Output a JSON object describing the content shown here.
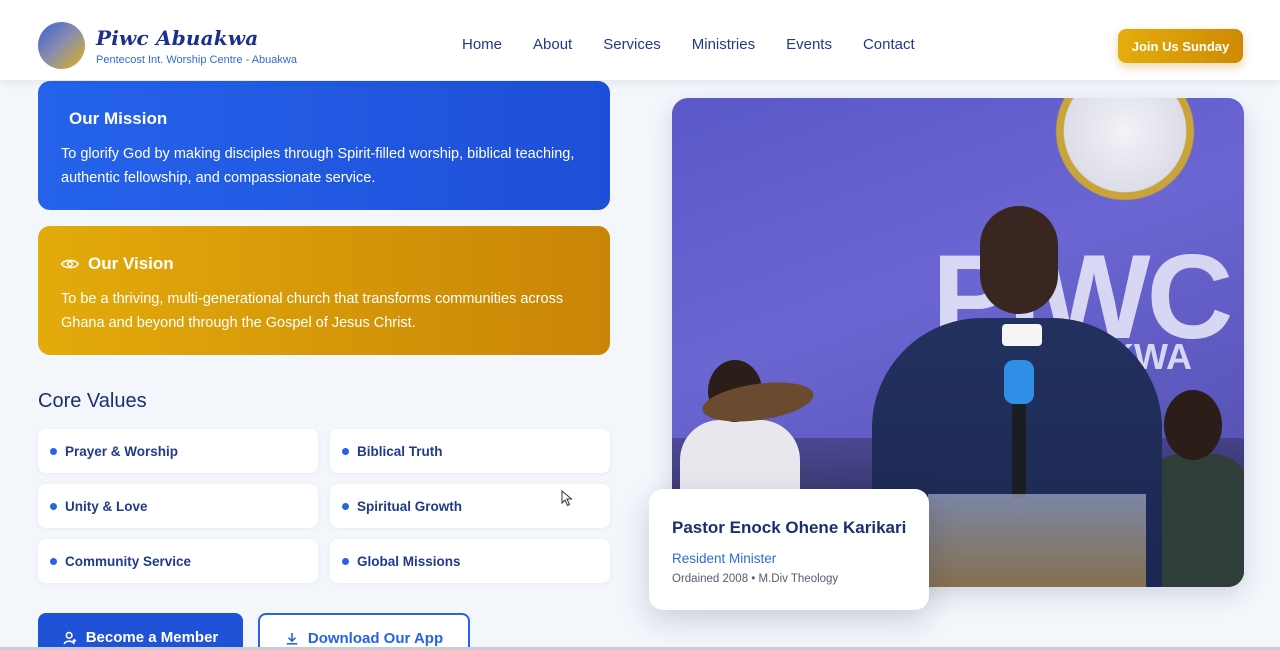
{
  "header": {
    "brand_name": "Piwc Abuakwa",
    "brand_sub": "Pentecost Int. Worship Centre - Abuakwa",
    "nav": [
      "Home",
      "About",
      "Services",
      "Ministries",
      "Events",
      "Contact"
    ],
    "cta": "Join Us Sunday"
  },
  "mission": {
    "title": "Our Mission",
    "text": "To glorify God by making disciples through Spirit-filled worship, biblical teaching, authentic fellowship, and compassionate service."
  },
  "vision": {
    "title": "Our Vision",
    "icon": "eye-icon",
    "text": "To be a thriving, multi-generational church that transforms communities across Ghana and beyond through the Gospel of Jesus Christ."
  },
  "core_values": {
    "title": "Core Values",
    "items": [
      "Prayer & Worship",
      "Biblical Truth",
      "Unity & Love",
      "Spiritual Growth",
      "Community Service",
      "Global Missions"
    ]
  },
  "buttons": {
    "member": "Become a Member",
    "member_icon": "user-plus-icon",
    "app": "Download Our App",
    "app_icon": "download-icon"
  },
  "pastor": {
    "name": "Pastor Enock Ohene Karikari",
    "role": "Resident Minister",
    "meta": "Ordained 2008 • M.Div Theology"
  },
  "photo": {
    "banner_big": "PIWC",
    "banner_sub": "AKWA"
  },
  "colors": {
    "primary_blue": "#2563eb",
    "gold": "#e3ab0b",
    "navy": "#1c2f6e"
  }
}
